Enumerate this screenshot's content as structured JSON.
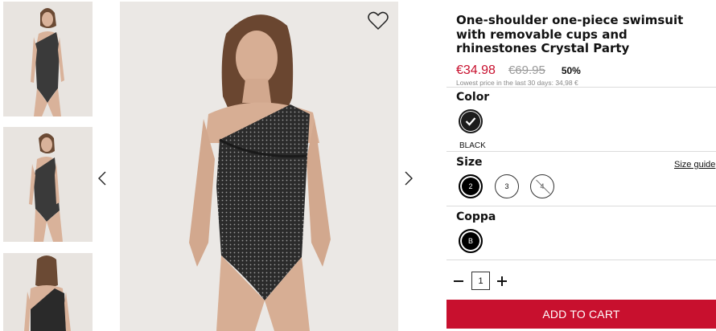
{
  "gallery": {
    "thumbnails": [
      {
        "alt": "front view"
      },
      {
        "alt": "side view"
      },
      {
        "alt": "back view"
      }
    ],
    "prev_icon": "chevron-left-icon",
    "next_icon": "chevron-right-icon",
    "wishlist_icon": "heart-icon"
  },
  "product": {
    "title": "One-shoulder one-piece swimsuit with removable cups and rhinestones Crystal Party",
    "price": "€34.98",
    "old_price": "€69.95",
    "discount": "50%",
    "lowest_price_note": "Lowest price in the last 30 days: 34,98 €"
  },
  "color": {
    "label": "Color",
    "selected": "BLACK",
    "swatch_color": "#1c1c1c"
  },
  "size": {
    "label": "Size",
    "guide_label": "Size guide",
    "options": [
      {
        "value": "2",
        "state": "selected"
      },
      {
        "value": "3",
        "state": "available"
      },
      {
        "value": "4",
        "state": "unavailable"
      }
    ]
  },
  "coppa": {
    "label": "Coppa",
    "options": [
      {
        "value": "B",
        "state": "selected"
      }
    ]
  },
  "quantity": {
    "value": "1"
  },
  "cart": {
    "label": "ADD TO CART",
    "color": "#c8102e"
  }
}
